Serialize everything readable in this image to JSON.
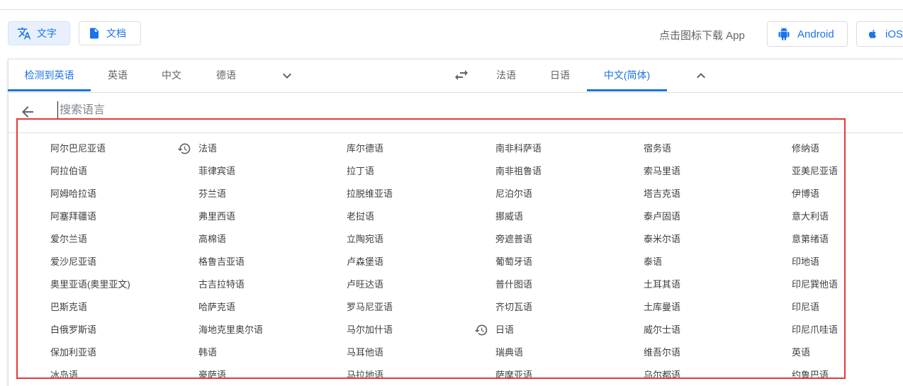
{
  "modes": {
    "text_label": "文字",
    "doc_label": "文档"
  },
  "download": {
    "label": "点击图标下载 App",
    "android": "Android",
    "ios": "iOS"
  },
  "source_tabs": [
    "检测到英语",
    "英语",
    "中文",
    "德语"
  ],
  "target_tabs": [
    "法语",
    "日语",
    "中文(简体)"
  ],
  "search": {
    "placeholder": "搜索语言"
  },
  "languages": [
    [
      "阿尔巴尼亚语",
      "法语",
      "库尔德语",
      "南非科萨语",
      "宿务语",
      "修纳语"
    ],
    [
      "阿拉伯语",
      "菲律宾语",
      "拉丁语",
      "南非祖鲁语",
      "索马里语",
      "亚美尼亚语"
    ],
    [
      "阿姆哈拉语",
      "芬兰语",
      "拉脱维亚语",
      "尼泊尔语",
      "塔吉克语",
      "伊博语"
    ],
    [
      "阿塞拜疆语",
      "弗里西语",
      "老挝语",
      "挪威语",
      "泰卢固语",
      "意大利语"
    ],
    [
      "爱尔兰语",
      "高棉语",
      "立陶宛语",
      "旁遮普语",
      "泰米尔语",
      "意第绪语"
    ],
    [
      "爱沙尼亚语",
      "格鲁吉亚语",
      "卢森堡语",
      "葡萄牙语",
      "泰语",
      "印地语"
    ],
    [
      "奥里亚语(奥里亚文)",
      "古吉拉特语",
      "卢旺达语",
      "普什图语",
      "土耳其语",
      "印尼巽他语"
    ],
    [
      "巴斯克语",
      "哈萨克语",
      "罗马尼亚语",
      "齐切瓦语",
      "土库曼语",
      "印尼语"
    ],
    [
      "白俄罗斯语",
      "海地克里奥尔语",
      "马尔加什语",
      "日语",
      "威尔士语",
      "印尼爪哇语"
    ],
    [
      "保加利亚语",
      "韩语",
      "马耳他语",
      "瑞典语",
      "维吾尔语",
      "英语"
    ],
    [
      "冰岛语",
      "豪萨语",
      "马拉地语",
      "萨摩亚语",
      "乌尔都语",
      "约鲁巴语"
    ]
  ]
}
